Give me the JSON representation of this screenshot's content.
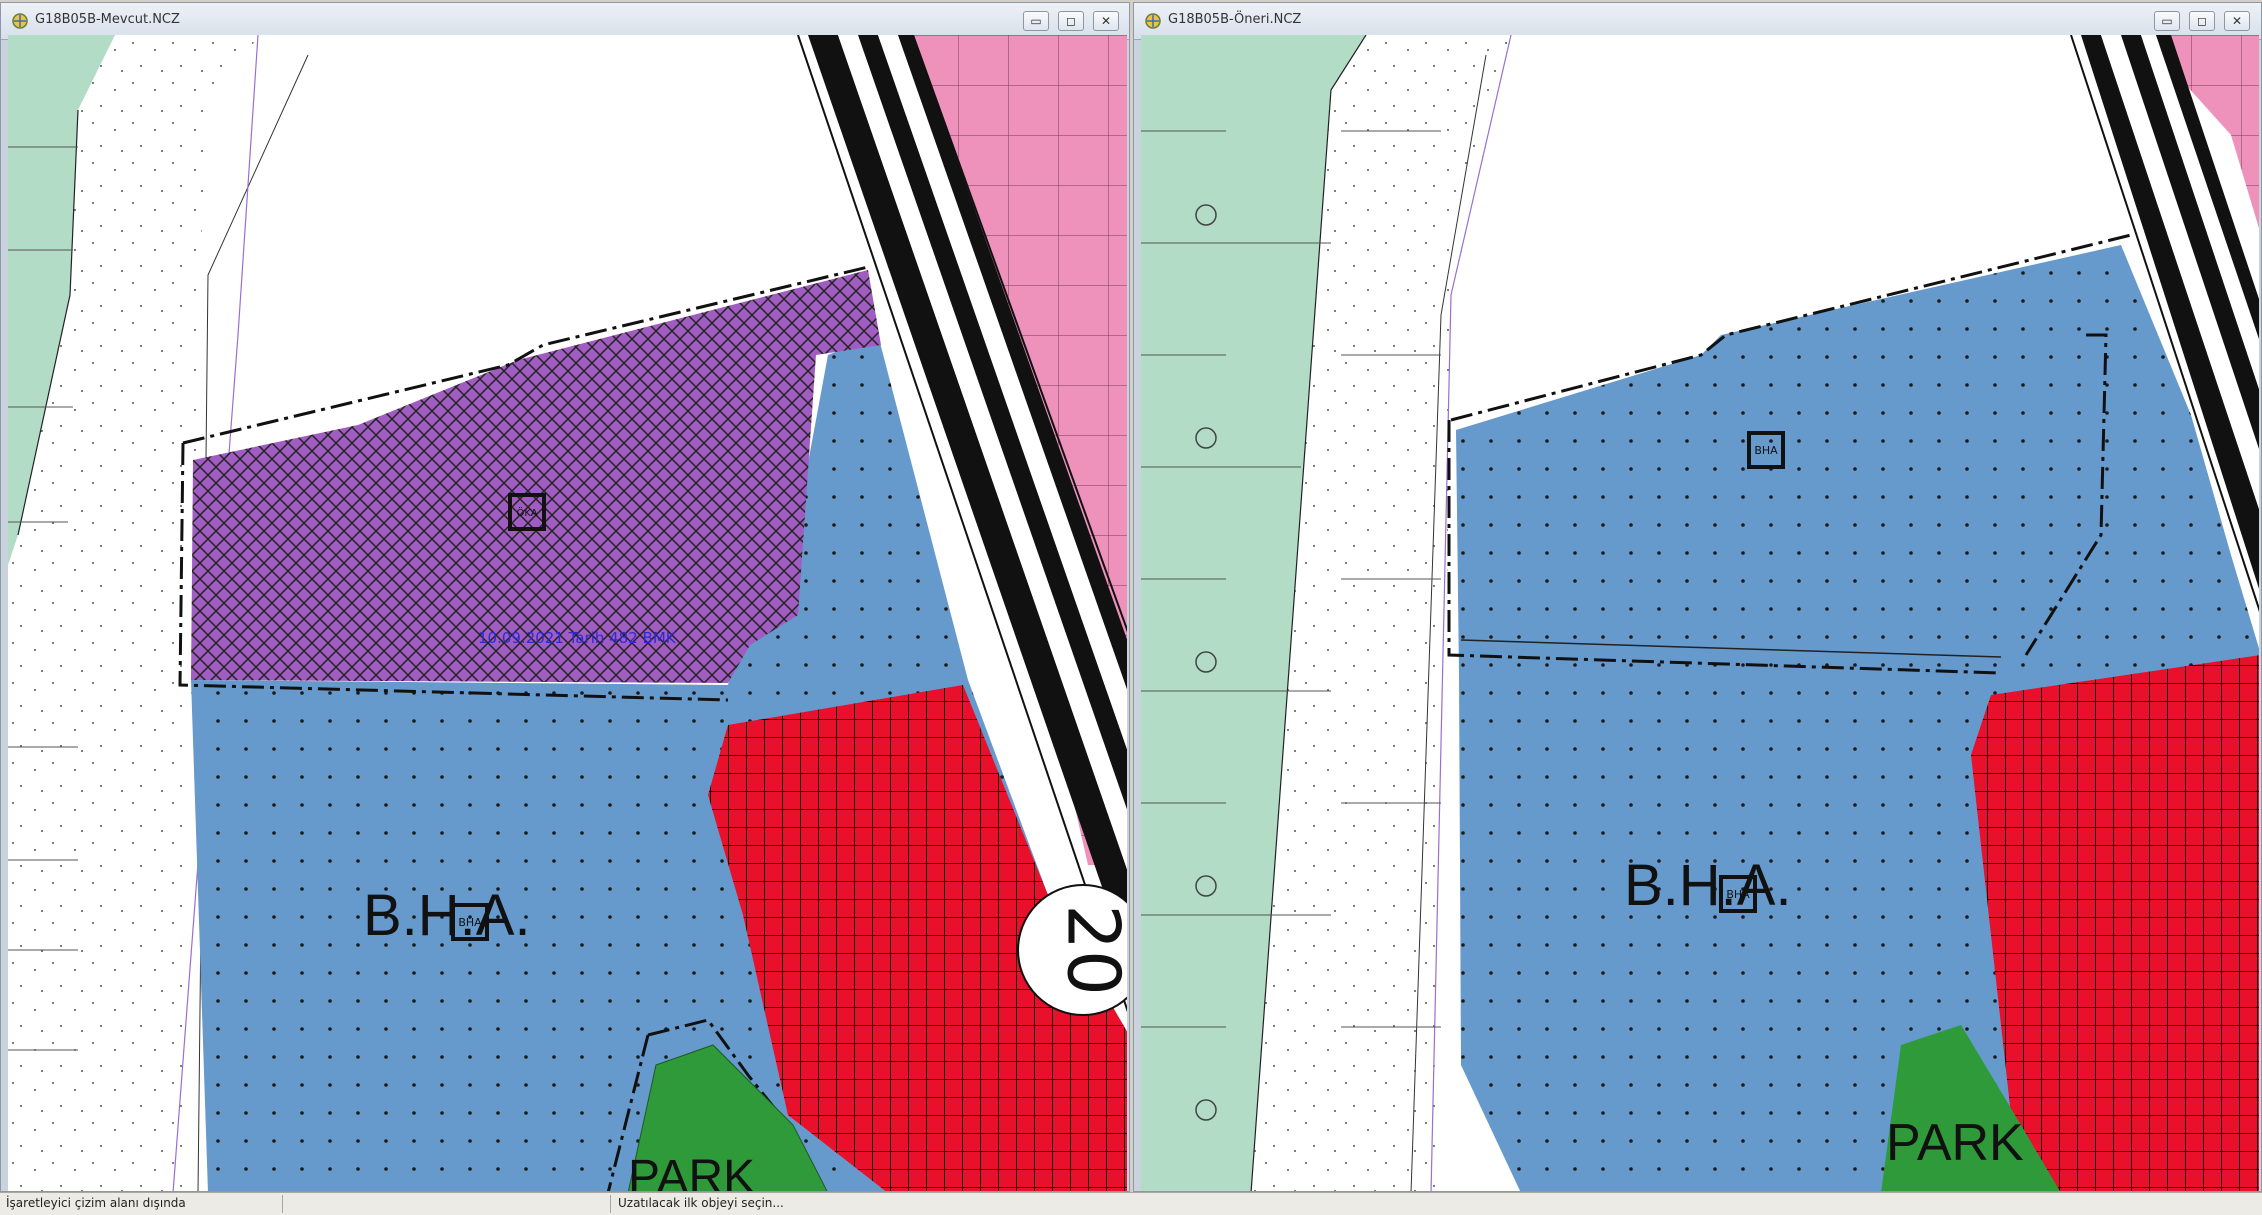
{
  "windows": {
    "left": {
      "title": "G18B05B-Mevcut.NCZ",
      "labels": {
        "zone": "B.H.A.",
        "zone_symbol": "BHA",
        "park": "PARK",
        "road_number": "20",
        "annotation": "10.09.2021 Tarih 482 BMK",
        "hatched_symbol": "ÖKA"
      }
    },
    "right": {
      "title": "G18B05B-Öneri.NCZ",
      "labels": {
        "zone": "B.H.A.",
        "zone_symbol": "BHA",
        "park": "PARK",
        "top_symbol": "BHA"
      }
    },
    "controls": {
      "minimize": "▭",
      "maximize": "◻",
      "close": "✕"
    }
  },
  "statusbar": {
    "left": "İşaretleyici çizim alanı dışında",
    "right": "Uzatılacak ilk objeyi seçin..."
  },
  "colors": {
    "blue_zone": "#6699cc",
    "red_zone": "#e8102a",
    "purple_zone": "#a05cc0",
    "park_green": "#2e9a3a",
    "pink_zone": "#ee92bc",
    "mint_strip": "#b2dcc6"
  }
}
